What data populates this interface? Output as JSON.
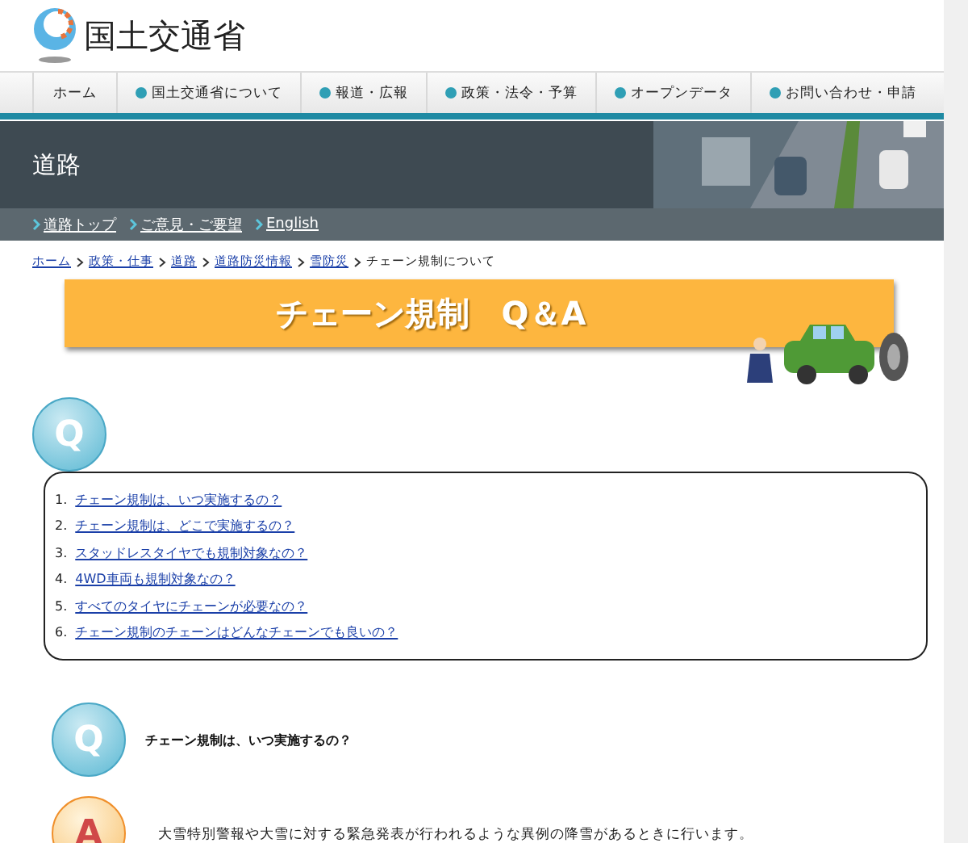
{
  "site": {
    "name": "国土交通省"
  },
  "nav": [
    {
      "label": "ホーム",
      "bullet": false
    },
    {
      "label": "国土交通省について",
      "bullet": true
    },
    {
      "label": "報道・広報",
      "bullet": true
    },
    {
      "label": "政策・法令・予算",
      "bullet": true
    },
    {
      "label": "オープンデータ",
      "bullet": true
    },
    {
      "label": "お問い合わせ・申請",
      "bullet": true
    }
  ],
  "section": {
    "title": "道路"
  },
  "subnav": [
    "道路トップ",
    "ご意見・ご要望",
    "English"
  ],
  "breadcrumb": {
    "links": [
      "ホーム",
      "政策・仕事",
      "道路",
      "道路防災情報",
      "雪防災"
    ],
    "current": "チェーン規制について"
  },
  "banner": {
    "title": "チェーン規制　Q＆A"
  },
  "index": {
    "badge": "Q",
    "items": [
      {
        "number": "1.",
        "text": "チェーン規制は、いつ実施するの？"
      },
      {
        "number": "2.",
        "text": "チェーン規制は、どこで実施するの？"
      },
      {
        "number": "3.",
        "text": "スタッドレスタイヤでも規制対象なの？"
      },
      {
        "number": "4.",
        "text": "4WD車両も規制対象なの？"
      },
      {
        "number": "5.",
        "text": "すべてのタイヤにチェーンが必要なの？"
      },
      {
        "number": "6.",
        "text": "チェーン規制のチェーンはどんなチェーンでも良いの？"
      }
    ]
  },
  "qa": [
    {
      "kind": "question",
      "badge": "Q",
      "text": "チェーン規制は、いつ実施するの？"
    },
    {
      "kind": "answer",
      "badge": "A",
      "text": "大雪特別警報や大雪に対する緊急発表が行われるような異例の降雪があるときに行います。"
    }
  ]
}
